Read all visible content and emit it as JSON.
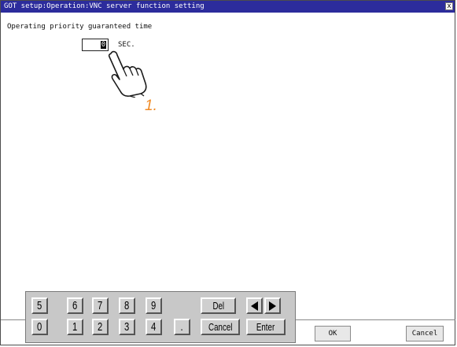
{
  "window": {
    "title": "GOT setup:Operation:VNC server function setting",
    "close_label": "x"
  },
  "setting": {
    "label": "Operating priority guaranteed time",
    "value": "0",
    "unit": "SEC."
  },
  "annotation": {
    "step": "1.",
    "step_color": "#f08a24",
    "pointer_icon": "hand-pointer-icon"
  },
  "keypad": {
    "row1": [
      "5",
      "6",
      "7",
      "8",
      "9"
    ],
    "row2": [
      "0",
      "1",
      "2",
      "3",
      "4"
    ],
    "decimal": ".",
    "del": "Del",
    "cancel": "Cancel",
    "enter": "Enter",
    "left_icon": "arrow-left-icon",
    "right_icon": "arrow-right-icon"
  },
  "buttons": {
    "ok": "OK",
    "cancel": "Cancel"
  },
  "colors": {
    "titlebar": "#2c2c9c",
    "keypad": "#c8c8c8"
  }
}
